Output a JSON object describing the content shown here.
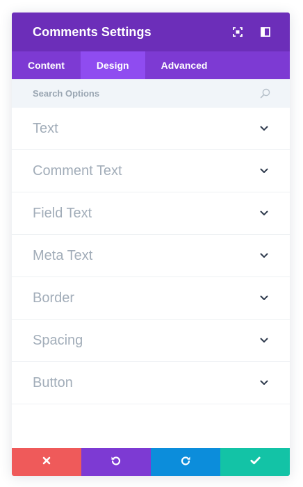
{
  "panel": {
    "title": "Comments Settings",
    "header_icons": [
      "fullscreen-icon",
      "sidebar-toggle-icon"
    ]
  },
  "tabs": [
    {
      "label": "Content",
      "active": false
    },
    {
      "label": "Design",
      "active": true
    },
    {
      "label": "Advanced",
      "active": false
    }
  ],
  "search": {
    "placeholder": "Search Options",
    "icon": "search-icon"
  },
  "sections": [
    {
      "label": "Text"
    },
    {
      "label": "Comment Text"
    },
    {
      "label": "Field Text"
    },
    {
      "label": "Meta Text"
    },
    {
      "label": "Border"
    },
    {
      "label": "Spacing"
    },
    {
      "label": "Button"
    }
  ],
  "footer": {
    "buttons": [
      {
        "name": "cancel",
        "icon": "close-icon",
        "color": "#ef5a5a"
      },
      {
        "name": "undo",
        "icon": "undo-icon",
        "color": "#7d3ad3"
      },
      {
        "name": "redo",
        "icon": "redo-icon",
        "color": "#0c8ddb"
      },
      {
        "name": "save",
        "icon": "checkmark-icon",
        "color": "#13c3a6"
      }
    ]
  },
  "colors": {
    "header_bg": "#6c2eb9",
    "tabs_bg": "#7d3ad3",
    "tab_active_bg": "#8f4cf0",
    "search_bg": "#f1f5f9",
    "section_label": "#a2adb9"
  }
}
